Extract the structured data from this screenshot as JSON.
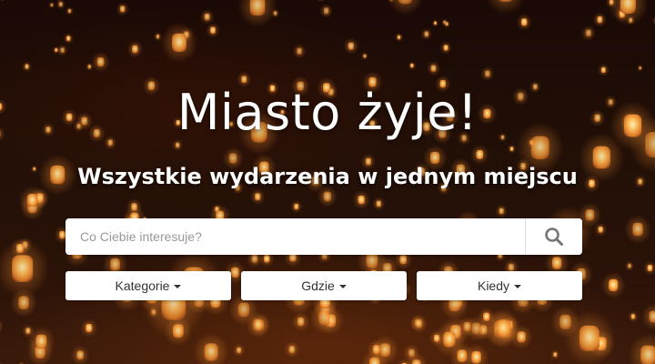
{
  "hero": {
    "title": "Miasto żyje!",
    "subtitle": "Wszystkie wydarzenia w jednym miejscu",
    "background": "lantern-festival-photo"
  },
  "search": {
    "placeholder": "Co Ciebie interesuje?",
    "value": "",
    "icon": "search-icon"
  },
  "filters": [
    {
      "label": "Kategorie",
      "icon": "caret-down-icon"
    },
    {
      "label": "Gdzie",
      "icon": "caret-down-icon"
    },
    {
      "label": "Kiedy",
      "icon": "caret-down-icon"
    }
  ],
  "colors": {
    "text_light": "#ffffff",
    "field_bg": "#ffffff",
    "lantern_glow": "#ffb347"
  }
}
